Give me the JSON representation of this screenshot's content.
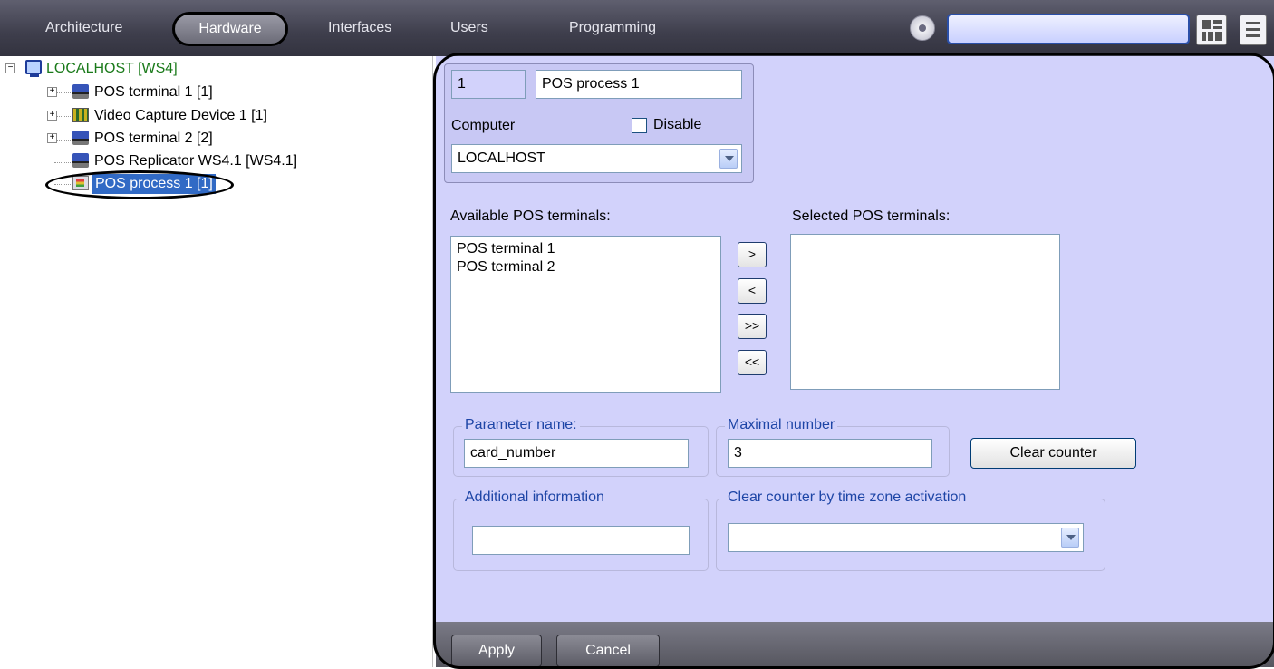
{
  "topbar": {
    "tabs": [
      "Architecture",
      "Hardware",
      "Interfaces",
      "Users",
      "Programming"
    ],
    "active_tab": "Hardware",
    "search_value": ""
  },
  "tree": {
    "root": "LOCALHOST [WS4]",
    "items": [
      {
        "label": "POS terminal 1 [1]",
        "icon": "pos-terminal-icon"
      },
      {
        "label": "Video Capture Device 1 [1]",
        "icon": "video-capture-icon"
      },
      {
        "label": "POS terminal 2 [2]",
        "icon": "pos-terminal-icon"
      },
      {
        "label": "POS Replicator WS4.1 [WS4.1]",
        "icon": "pos-terminal-icon"
      },
      {
        "label": "POS process 1 [1]",
        "icon": "pos-process-icon"
      }
    ]
  },
  "form": {
    "id_value": "1",
    "name_value": "POS process 1",
    "computer_label": "Computer",
    "disable_label": "Disable",
    "computer_value": "LOCALHOST",
    "available_label": "Available POS terminals:",
    "selected_label": "Selected POS terminals:",
    "available_items": [
      "POS terminal 1",
      "POS terminal 2"
    ],
    "move_buttons": [
      ">",
      "<",
      ">>",
      "<<"
    ],
    "param_title": "Parameter name:",
    "param_value": "card_number",
    "max_title": "Maximal number",
    "max_value": "3",
    "clear_counter_label": "Clear counter",
    "additional_title": "Additional information",
    "additional_value": "",
    "clear_tz_title": "Clear counter by time zone activation",
    "clear_tz_value": ""
  },
  "footer": {
    "apply_label": "Apply",
    "cancel_label": "Cancel"
  }
}
